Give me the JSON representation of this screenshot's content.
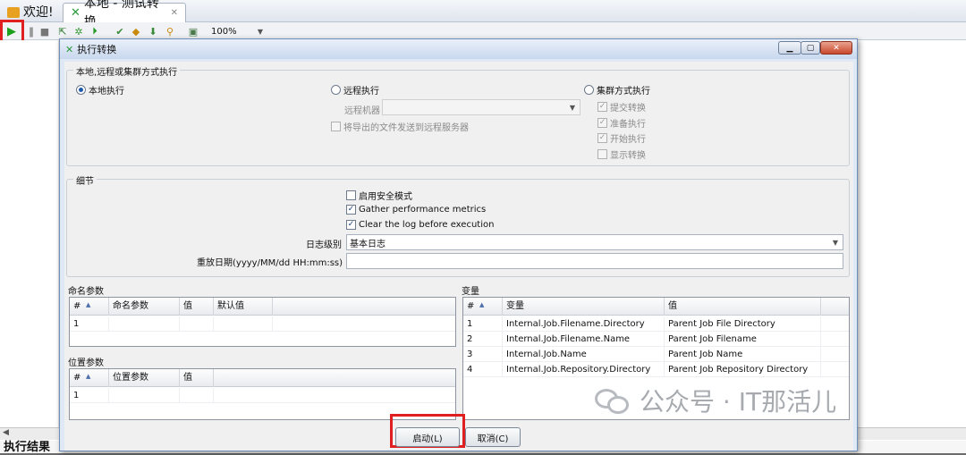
{
  "tabs": [
    {
      "label": "欢迎!",
      "icon": "welcome-icon"
    },
    {
      "label": "本地 - 测试转换",
      "icon": "transformation-icon",
      "closable": true
    }
  ],
  "toolbar": {
    "zoom": "100%"
  },
  "bottom_label": "执行结果",
  "dialog": {
    "title": "执行转换",
    "exec_group": {
      "title": "本地,远程或集群方式执行",
      "local": "本地执行",
      "remote": "远程执行",
      "cluster": "集群方式执行",
      "remote_host_label": "远程机器",
      "remote_host_value": "",
      "send_files": "将导出的文件发送到远程服务器",
      "cluster_options": [
        "提交转换",
        "准备执行",
        "开始执行",
        "显示转换"
      ],
      "cluster_checked": [
        true,
        true,
        true,
        false
      ]
    },
    "details": {
      "title": "细节",
      "safe_mode": "启用安全模式",
      "safe_mode_checked": false,
      "perf_metrics": "Gather performance metrics",
      "perf_metrics_checked": true,
      "clear_log": "Clear the log before execution",
      "clear_log_checked": true,
      "log_level_label": "日志级别",
      "log_level_value": "基本日志",
      "replay_label": "重放日期(yyyy/MM/dd HH:mm:ss)",
      "replay_value": ""
    },
    "named_params": {
      "title": "命名参数",
      "columns": [
        "#",
        "命名参数",
        "值",
        "默认值"
      ],
      "rows": [
        [
          "1",
          "",
          "",
          ""
        ]
      ]
    },
    "positional_params": {
      "title": "位置参数",
      "columns": [
        "#",
        "位置参数",
        "值"
      ],
      "rows": [
        [
          "1",
          "",
          ""
        ]
      ]
    },
    "variables": {
      "title": "变量",
      "columns": [
        "#",
        "变量",
        "值"
      ],
      "rows": [
        [
          "1",
          "Internal.Job.Filename.Directory",
          "Parent Job File Directory"
        ],
        [
          "2",
          "Internal.Job.Filename.Name",
          "Parent Job Filename"
        ],
        [
          "3",
          "Internal.Job.Name",
          "Parent Job Name"
        ],
        [
          "4",
          "Internal.Job.Repository.Directory",
          "Parent Job Repository Directory"
        ]
      ]
    },
    "buttons": {
      "launch": "启动(L)",
      "cancel": "取消(C)"
    }
  },
  "watermark": "公众号 · IT那活儿",
  "colors": {
    "highlight": "#e02020",
    "dialog_bg": "#f0f0f0",
    "title_bar": "#c9d8ee"
  }
}
